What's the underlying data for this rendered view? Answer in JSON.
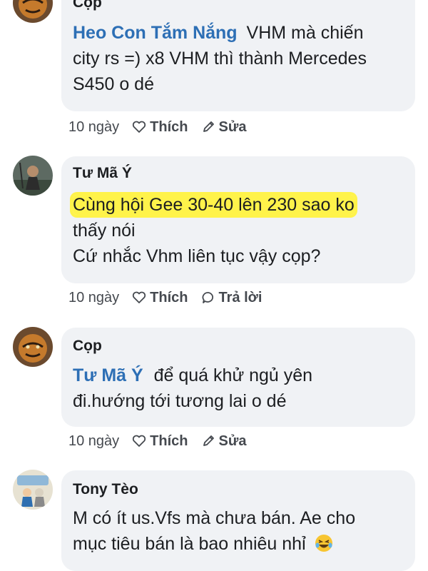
{
  "comments": [
    {
      "author": "Cọp",
      "mention": "Heo Con Tắm Nắng",
      "lines": [
        "VHM mà chiến",
        "city rs =) x8 VHM thì thành Mercedes",
        "S450 o dé"
      ],
      "time": "10 ngày",
      "like": "Thích",
      "second_action": "Sửa"
    },
    {
      "author": "Tư Mã Ý",
      "lines": [
        "Cùng hội Gee 30-40 lên 230 sao ko",
        "thấy nói",
        "Cứ nhắc Vhm liên tục vậy cọp?"
      ],
      "time": "10 ngày",
      "like": "Thích",
      "second_action": "Trả lời"
    },
    {
      "author": "Cọp",
      "mention": "Tư Mã Ý",
      "lines": [
        "để quá khử ngủ yên",
        "đi.hướng tới tương lai o dé"
      ],
      "time": "10 ngày",
      "like": "Thích",
      "second_action": "Sửa"
    },
    {
      "author": "Tony Tèo",
      "lines": [
        "M có ít us.Vfs mà chưa bán. Ae cho",
        "mục tiêu bán là bao nhiêu nhỉ"
      ],
      "emoji": "😂"
    }
  ],
  "colors": {
    "mention": "#2d6fb5",
    "bubble": "#f0f2f5",
    "highlight": "#fff34a",
    "action_text": "#45494f"
  },
  "icons": [
    "heart-outline-icon",
    "pencil-icon",
    "speech-bubble-icon",
    "laughing-emoji-icon"
  ]
}
